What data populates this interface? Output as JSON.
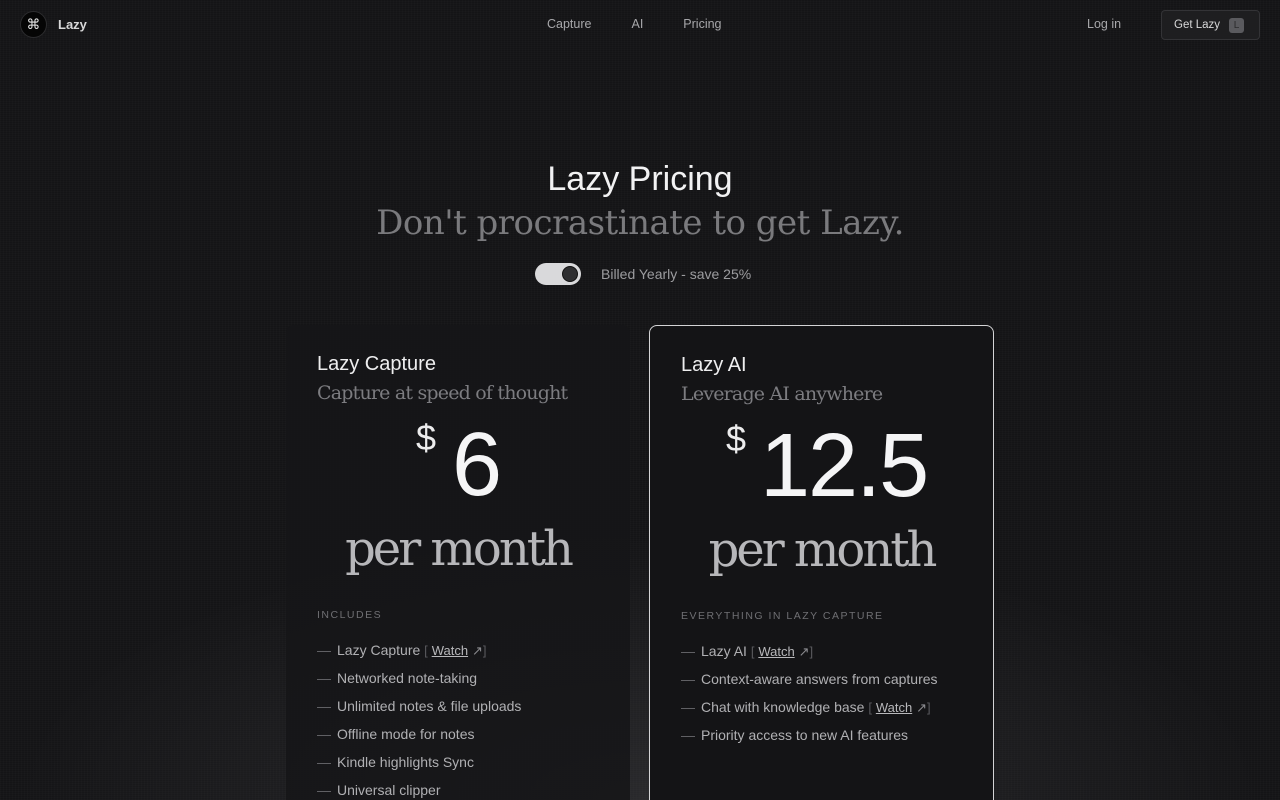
{
  "nav": {
    "brand": "Lazy",
    "logo_icon": "⌘",
    "links": [
      "Capture",
      "AI",
      "Pricing"
    ],
    "login": "Log in",
    "cta": "Get Lazy",
    "cta_shortcut": "L"
  },
  "hero": {
    "title": "Lazy Pricing",
    "subtitle": "Don't procrastinate to get Lazy.",
    "billing_label": "Billed Yearly - save 25%",
    "billing_yearly": true
  },
  "plans": [
    {
      "name": "Lazy Capture",
      "tagline": "Capture at speed of thought",
      "currency": "$",
      "price": "6",
      "period": "per month",
      "includes_label": "INCLUDES",
      "features": [
        {
          "text": "Lazy Capture",
          "watch": "Watch"
        },
        {
          "text": "Networked note-taking"
        },
        {
          "text": "Unlimited notes & file uploads"
        },
        {
          "text": "Offline mode for notes"
        },
        {
          "text": "Kindle highlights Sync"
        },
        {
          "text": "Universal clipper"
        }
      ]
    },
    {
      "name": "Lazy AI",
      "tagline": "Leverage AI anywhere",
      "currency": "$",
      "price": "12.5",
      "period": "per month",
      "includes_label": "EVERYTHING IN LAZY CAPTURE",
      "features": [
        {
          "text": "Lazy AI",
          "watch": "Watch"
        },
        {
          "text": "Context-aware answers from captures"
        },
        {
          "text": "Chat with knowledge base",
          "watch": "Watch"
        },
        {
          "text": "Priority access to new AI features"
        }
      ]
    }
  ],
  "glyphs": {
    "dash": "—",
    "arrow": "↗",
    "bracket_open": "[",
    "bracket_close": "]"
  }
}
